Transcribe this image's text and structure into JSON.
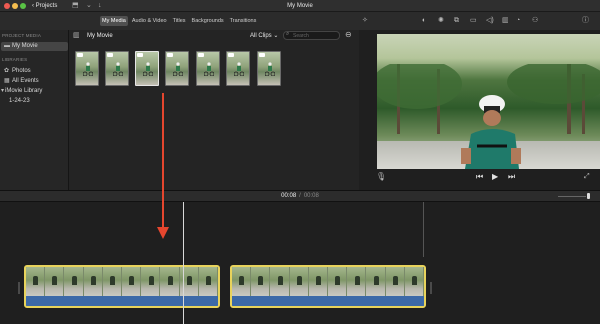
{
  "window": {
    "title": "My Movie",
    "projects_label": "Projects",
    "icons": [
      "close-icon",
      "minimize-icon",
      "zoom-icon",
      "import-icon",
      "download-icon"
    ]
  },
  "media_tabs": [
    {
      "label": "My Media",
      "active": true
    },
    {
      "label": "Audio & Video",
      "active": false
    },
    {
      "label": "Titles",
      "active": false
    },
    {
      "label": "Backgrounds",
      "active": false
    },
    {
      "label": "Transitions",
      "active": false
    }
  ],
  "viewer_tools": [
    "magic-wand-icon",
    "color-balance-icon",
    "color-correction-icon",
    "crop-icon",
    "stabilization-icon",
    "volume-icon",
    "noise-reduction-icon",
    "speed-icon",
    "clip-filter-icon",
    "info-icon"
  ],
  "sidebar": {
    "project_media_heading": "PROJECT MEDIA",
    "project_item": "My Movie",
    "libraries_heading": "LIBRARIES",
    "items": [
      {
        "label": "Photos",
        "icon": "photos-icon"
      },
      {
        "label": "All Events",
        "icon": "events-icon"
      },
      {
        "label": "iMovie Library",
        "icon": "disclosure-triangle-icon"
      },
      {
        "label": "1-24-23",
        "icon": ""
      }
    ]
  },
  "browser": {
    "title": "My Movie",
    "filter_label": "All Clips",
    "search_placeholder": "Search",
    "clip_count": 7
  },
  "viewer": {
    "controls": [
      "skip-back-icon",
      "play-icon",
      "skip-forward-icon"
    ]
  },
  "timeline": {
    "current_time": "00:08",
    "separator": "/",
    "total_time": "00:08",
    "clips": 2
  },
  "colors": {
    "accent_selection": "#e8d35c",
    "annotation_arrow": "#e5462e",
    "audio_track": "#3c69a8"
  }
}
